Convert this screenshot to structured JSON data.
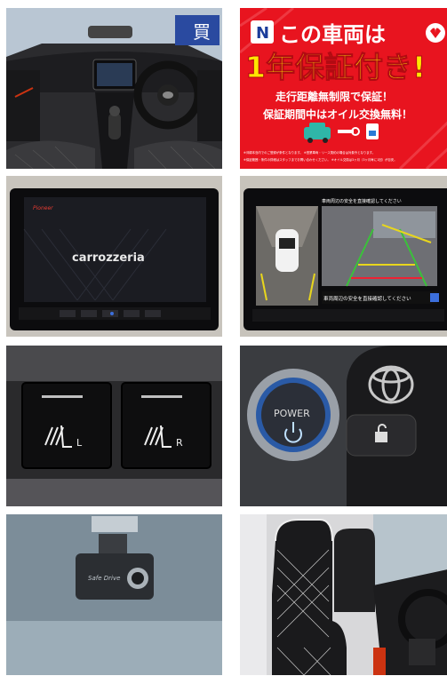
{
  "photos": [
    {
      "id": "dashboard",
      "screen_label": "",
      "sign_text": "買"
    },
    {
      "id": "warranty-banner",
      "banner": {
        "logo": "N",
        "headline_line1": "この車両は",
        "headline_line2": "1年保証付き!",
        "sub_line1": "走行距離無制限で保証！",
        "sub_line2": "保証期間中はオイル交換無料！",
        "fine_print_1": "※沖縄本島内でのご登録が条件となります。 ※営業車両・リース契約の場合は対象外となります。",
        "fine_print_2": "※保証範囲・条件の詳細はスタッフまでお問い合わせください。 ※オイル交換は3ヶ月（3ヶ月毎に1回）が目安。"
      },
      "colors": {
        "banner_red": "#e8141f",
        "banner_text_yellow": "#ffe600"
      }
    },
    {
      "id": "navigation-screen",
      "brand_top": "Pioneer",
      "brand_screen": "carrozzeria"
    },
    {
      "id": "camera-view",
      "warning_top": "車両周辺の安全を直接確認してください",
      "warning_bottom": "車両周辺の安全を直接確認してください"
    },
    {
      "id": "seat-heater-switches",
      "left_label": "L",
      "right_label": "R"
    },
    {
      "id": "power-button-key",
      "power_label": "POWER"
    },
    {
      "id": "dashcam",
      "dashcam_label": "Safe Drive"
    },
    {
      "id": "seats"
    }
  ]
}
